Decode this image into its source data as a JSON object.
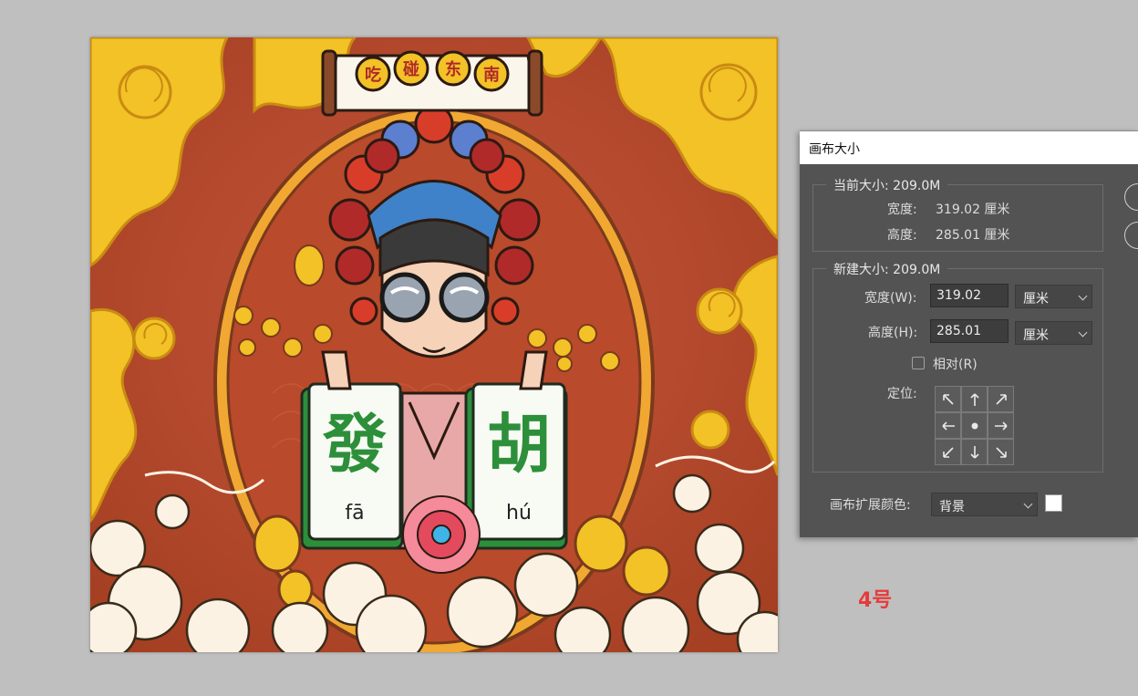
{
  "artwork": {
    "banner_chars": [
      "吃",
      "碰",
      "东",
      "南"
    ],
    "tile_left": {
      "char": "發",
      "pinyin": "fā"
    },
    "tile_right": {
      "char": "胡",
      "pinyin": "hú"
    },
    "colors": {
      "background": "#b9482a",
      "gold": "#f2c226",
      "tile_green": "#2d8f3a"
    }
  },
  "dialog": {
    "title": "画布大小",
    "current": {
      "legend": "当前大小: 209.0M",
      "width_label": "宽度:",
      "width_value": "319.02 厘米",
      "height_label": "高度:",
      "height_value": "285.01 厘米"
    },
    "new": {
      "legend": "新建大小: 209.0M",
      "width_label": "宽度(W):",
      "width_value": "319.02",
      "width_unit": "厘米",
      "height_label": "高度(H):",
      "height_value": "285.01",
      "height_unit": "厘米",
      "relative_label": "相对(R)",
      "relative_checked": false,
      "anchor_label": "定位:"
    },
    "extension": {
      "label": "画布扩展颜色:",
      "value": "背景",
      "swatch_color": "#ffffff"
    }
  },
  "note": "4号"
}
